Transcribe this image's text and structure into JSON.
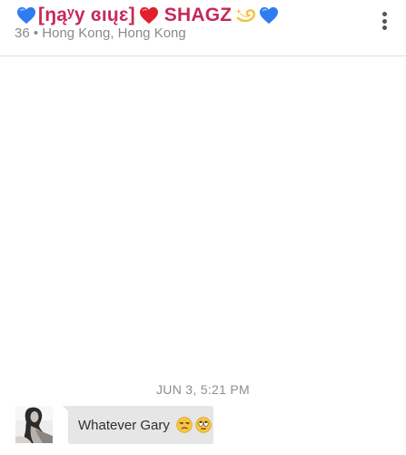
{
  "header": {
    "title_before_heart": "[ŋąʸy ɞıųɛ]",
    "title_after_heart": "SHAGZ",
    "subtitle": "36 • Hong Kong, Hong Kong",
    "icons": [
      "blue-heart-icon",
      "red-heart-icon",
      "dizzy-icon",
      "blue-heart-icon",
      "more-vertical-icon"
    ],
    "colors": {
      "title": "#c52a57",
      "blue_heart": "#2f7cf0",
      "red_heart": "#e0202e"
    }
  },
  "conversation": {
    "timestamp": "JUN 3, 5:21 PM",
    "messages": [
      {
        "text": "Whatever Gary",
        "emojis": [
          "unamused-face-icon",
          "rolling-eyes-face-icon"
        ]
      }
    ]
  }
}
